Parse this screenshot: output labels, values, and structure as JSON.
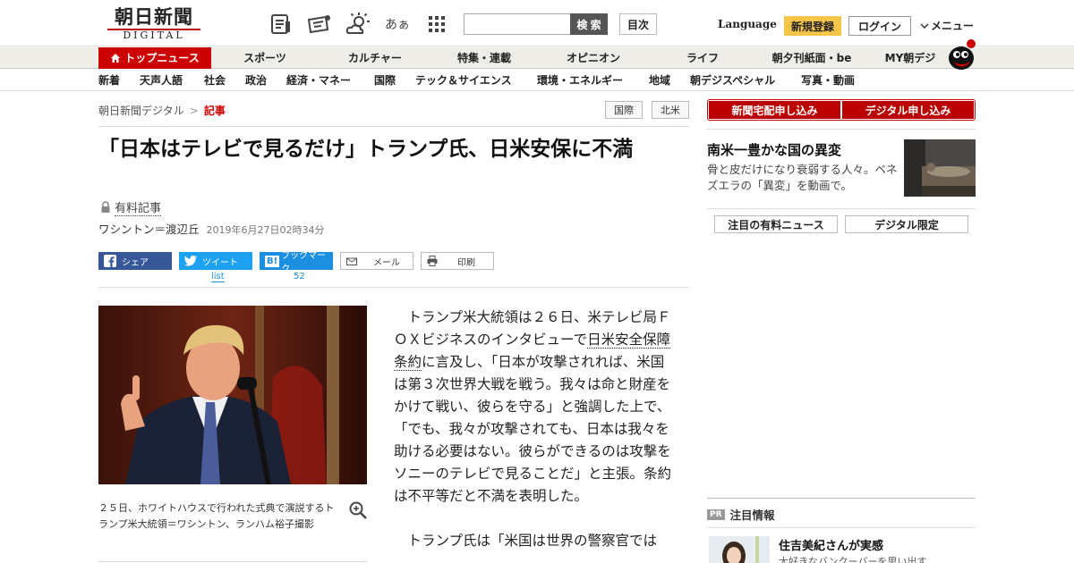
{
  "header": {
    "logo_main": "朝日新聞",
    "logo_sub": "DIGITAL",
    "search_button": "検 索",
    "toc_button": "目次",
    "language": "Language",
    "register": "新規登録",
    "login": "ログイン",
    "menu": "メニュー",
    "icons": [
      "newspaper-icon",
      "coupon-icon",
      "weather-icon",
      "font-size-icon",
      "grid-apps-icon"
    ],
    "font_size_glyph": "あぁ"
  },
  "nav1": {
    "items": [
      "トップニュース",
      "スポーツ",
      "カルチャー",
      "特集・連載",
      "オピニオン",
      "ライフ",
      "朝夕刊紙面・be",
      "MY朝デジ"
    ]
  },
  "nav2": {
    "items": [
      "新着",
      "天声人語",
      "社会",
      "政治",
      "経済・マネー",
      "国際",
      "テック＆サイエンス",
      "環境・エネルギー",
      "地域",
      "朝デジスペシャル",
      "写真・動画"
    ]
  },
  "breadcrumb": {
    "root": "朝日新聞デジタル",
    "sep": ">",
    "current": "記事"
  },
  "tags": [
    "国際",
    "北米"
  ],
  "article": {
    "headline": "「日本はテレビで見るだけ」トランプ氏、日米安保に不満",
    "paid_label": "有料記事",
    "byline": "ワシントン＝渡辺丘",
    "date": "2019年6月27日02時34分",
    "share": {
      "facebook": "シェア",
      "twitter": "ツイート",
      "twitter_count": "list",
      "hatena": "ブックマーク",
      "hatena_count": "52",
      "mail": "メール",
      "print": "印刷"
    },
    "caption": "２５日、ホワイトハウスで行われた式典で演説するトランプ米大統領＝ワシントン、ランハム裕子撮影",
    "p1_a": "トランプ米大統領は２６日、米テレビ局ＦＯＸビジネスのインタビューで",
    "p1_link": "日米安全保障条約",
    "p1_b": "に言及し、「日本が攻撃されれば、米国は第３次世界大戦を戦う。我々は命と財産をかけて戦い、彼らを守る」と強調した上で、「でも、我々が攻撃されても、日本は我々を助ける必要はない。彼らができるのは攻撃をソニーのテレビで見ることだ」と主張。条約は不平等だと不満を表明した。",
    "p2": "トランプ氏は「米国は世界の警察官では"
  },
  "sidebar": {
    "subscribe_paper": "新聞宅配申し込み",
    "subscribe_digital": "デジタル申し込み",
    "promo_title": "南米一豊かな国の異変",
    "promo_desc": "骨と皮だけになり衰弱する人々。ベネズエラの「異変」を動画で。",
    "tab1": "注目の有料ニュース",
    "tab2": "デジタル限定",
    "pr_badge": "PR",
    "pr_heading": "注目情報",
    "pr_title": "住吉美紀さんが実感",
    "pr_desc": "大好きなバンクーバーを思い出す"
  },
  "colors": {
    "brand_red": "#cc0000",
    "register_yellow": "#f5c54a",
    "facebook": "#365899",
    "twitter": "#1da1f2",
    "hatena": "#1d8fe1"
  }
}
